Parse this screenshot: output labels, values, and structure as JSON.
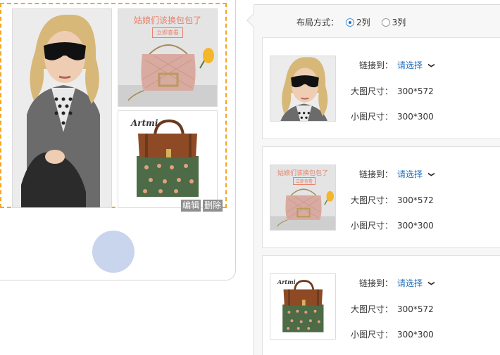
{
  "preview": {
    "banner_title": "姑娘们该换包包了",
    "banner_button": "立即查看",
    "brand_text": "Artmi",
    "edit_label": "编辑",
    "delete_label": "删除"
  },
  "panel": {
    "layout_label": "布局方式：",
    "options": [
      {
        "label": "2列",
        "selected": true
      },
      {
        "label": "3列",
        "selected": false
      }
    ],
    "link_label": "链接到：",
    "select_placeholder": "请选择",
    "big_size_label": "大图尺寸：",
    "small_size_label": "小图尺寸：",
    "items": [
      {
        "thumb": "woman-sunglasses-photo",
        "link": "请选择",
        "big_size": "300*572",
        "small_size": "300*300"
      },
      {
        "thumb": "pink-bag-banner-photo",
        "link": "请选择",
        "big_size": "300*572",
        "small_size": "300*300"
      },
      {
        "thumb": "brown-green-bag-photo",
        "link": "请选择",
        "big_size": "300*572",
        "small_size": "300*300"
      }
    ]
  },
  "colors": {
    "selection_border": "#f5a623",
    "link": "#1f6fbf",
    "banner_text": "#e9826b",
    "home_button": "#c9d5ec"
  }
}
